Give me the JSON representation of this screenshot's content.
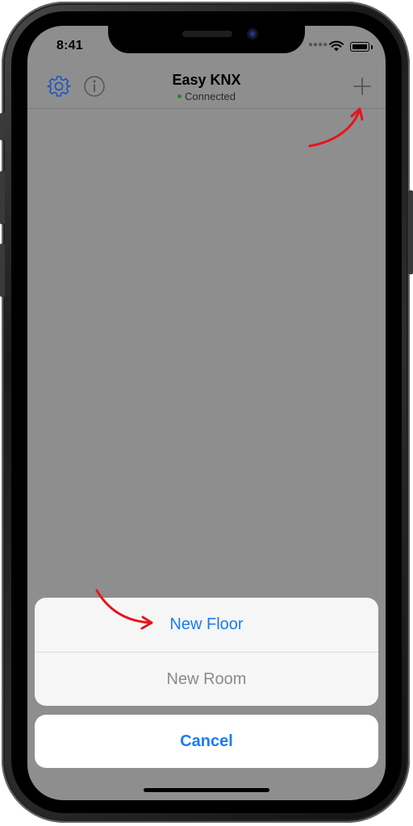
{
  "status_bar": {
    "time": "8:41",
    "signal_icon": "signal-dots-icon",
    "wifi_icon": "wifi-icon",
    "battery_icon": "battery-icon"
  },
  "navbar": {
    "title": "Easy KNX",
    "subtitle": "Connected",
    "connection_color": "#1c8a2f",
    "left_icons": [
      "gear-icon",
      "info-icon"
    ],
    "right_icon": "plus-icon"
  },
  "action_sheet": {
    "options": [
      {
        "label": "New Floor",
        "enabled": true,
        "color": "#1a7cf5"
      },
      {
        "label": "New Room",
        "enabled": false,
        "color": "#8a8a8a"
      }
    ],
    "cancel_label": "Cancel",
    "cancel_color": "#1a7cf5"
  },
  "colors": {
    "accent": "#1a7cf5",
    "dimmed_background": "#8e8e8f",
    "annotation_arrow": "#e8141b"
  }
}
